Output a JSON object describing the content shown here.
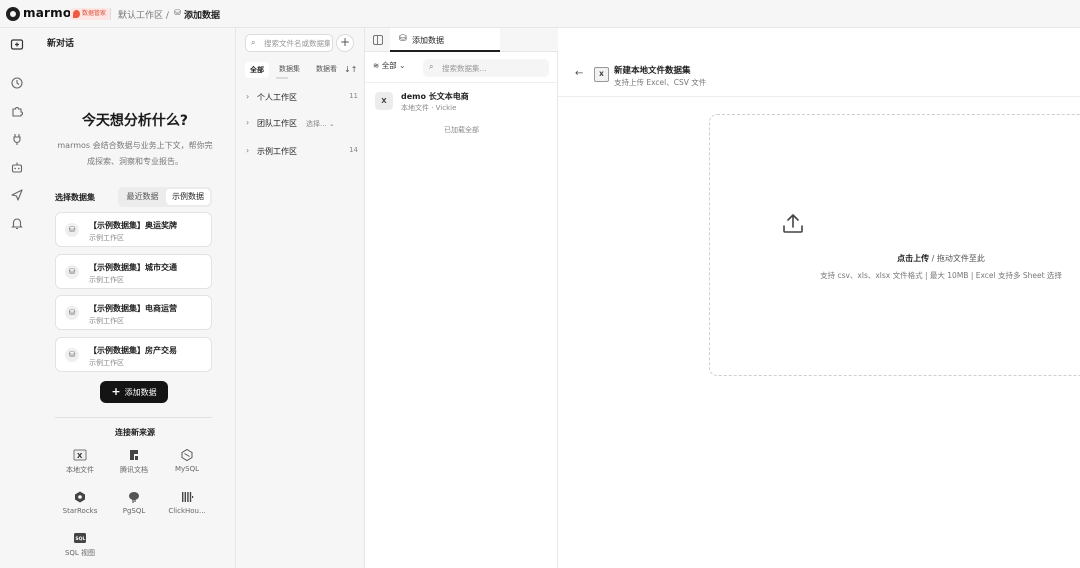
{
  "topbar": {
    "brand": "marmos",
    "badge": "数据管家",
    "breadcrumb_workspace": "默认工作区 /",
    "breadcrumb_current": "添加数据"
  },
  "chat": {
    "title": "新对话",
    "hero": "今天想分析什么?",
    "hero_sub": "marmos 会结合数据与业务上下文，帮你完成探索、洞察和专业报告。",
    "select_label": "选择数据集",
    "seg_recent": "最近数据",
    "seg_sample": "示例数据",
    "datasets": [
      {
        "name": "【示例数据集】奥运奖牌",
        "ws": "示例工作区"
      },
      {
        "name": "【示例数据集】城市交通",
        "ws": "示例工作区"
      },
      {
        "name": "【示例数据集】电商运营",
        "ws": "示例工作区"
      },
      {
        "name": "【示例数据集】房产交易",
        "ws": "示例工作区"
      }
    ],
    "add_button": "添加数据",
    "connect_title": "连接新来源",
    "sources": [
      {
        "label": "本地文件",
        "icon": "excel-file-icon"
      },
      {
        "label": "腾讯文档",
        "icon": "tencent-docs-icon"
      },
      {
        "label": "MySQL",
        "icon": "mysql-icon"
      },
      {
        "label": "StarRocks",
        "icon": "starrocks-icon"
      },
      {
        "label": "PgSQL",
        "icon": "postgresql-icon"
      },
      {
        "label": "ClickHou...",
        "icon": "clickhouse-icon"
      },
      {
        "label": "SQL 视图",
        "icon": "sql-view-icon"
      }
    ]
  },
  "tree": {
    "search_placeholder": "搜索文件名或数据集",
    "tabs": [
      "全部",
      "数据集",
      "数据看板"
    ],
    "rows": [
      {
        "name": "个人工作区",
        "count": "11"
      },
      {
        "name": "团队工作区",
        "select": "选择..."
      },
      {
        "name": "示例工作区",
        "count": "14"
      }
    ]
  },
  "list": {
    "tab_label": "添加数据",
    "filter": "全部",
    "search_placeholder": "搜索数据集...",
    "file_name": "demo 长文本电商",
    "file_meta": "本地文件 · Vickie",
    "loaded": "已加载全部"
  },
  "main": {
    "title": "新建本地文件数据集",
    "subtitle": "支持上传 Excel、CSV 文件",
    "upload_strong": "点击上传",
    "upload_rest": " / 拖动文件至此",
    "upload_hint": "支持 csv、xls、xlsx 文件格式 | 最大 10MB | Excel 支持多 Sheet 选择"
  }
}
